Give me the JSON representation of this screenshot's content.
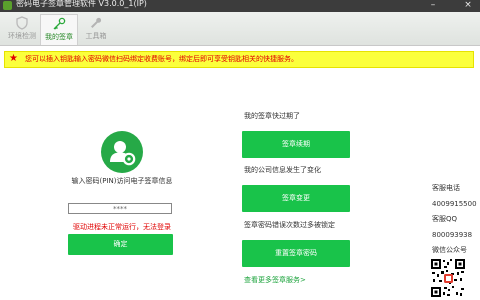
{
  "window": {
    "title": "密码电子签章管理软件 V3.0.0_1(IP)"
  },
  "tabs": [
    {
      "label": "环境检测",
      "icon": "shield-icon"
    },
    {
      "label": "我的签章",
      "icon": "key-icon"
    },
    {
      "label": "工具箱",
      "icon": "wrench-icon"
    }
  ],
  "notice": {
    "text": "您可以插入钥匙输入密码微信扫码绑定收费账号，绑定后即可享受钥匙相关的快捷服务。",
    "icon": "star-icon"
  },
  "login": {
    "avatar_icon": "user-gear-icon",
    "prompt": "输入密码(PIN)访问电子签章信息",
    "pin_value": "****",
    "error": "驱动进程未正常运行，无法登录",
    "confirm_label": "确定"
  },
  "actions": [
    {
      "label": "我的签章快过期了",
      "button": "签章续期"
    },
    {
      "label": "我的公司信息发生了变化",
      "button": "签章变更"
    },
    {
      "label": "签章密码错误次数过多被锁定",
      "button": "重置签章密码"
    }
  ],
  "more_link": "查看更多签章服务>",
  "contact": {
    "phone_label": "客服电话",
    "phone": "4009915500",
    "qq_label": "客服QQ",
    "qq": "800093938",
    "wechat_label": "微信公众号"
  },
  "colors": {
    "accent": "#19c34a",
    "notice_bg": "#fbff3c",
    "error": "#e00000",
    "titlebar": "#3c3c3c"
  }
}
